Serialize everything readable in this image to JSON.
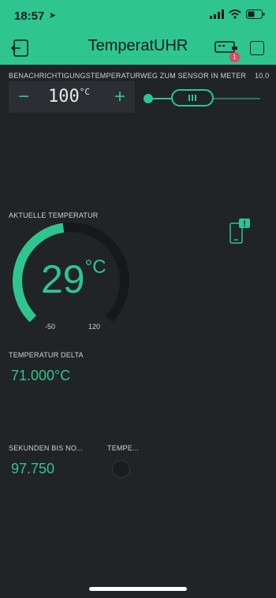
{
  "status": {
    "time": "18:57"
  },
  "header": {
    "title": "TemperatUHR",
    "notification_badge": "1"
  },
  "widgets": {
    "notify_temp": {
      "label": "BENACHRICHTIGUNGSTEMPERATUR",
      "minus": "−",
      "plus": "+",
      "value": "100",
      "unit": "°C"
    },
    "distance_slider": {
      "label": "WEG ZUM SENSOR IN METER",
      "value": "10.0",
      "level_fraction": 0.35
    },
    "current_temp": {
      "label": "AKTUELLE TEMPERATUR",
      "value": "29",
      "unit": "°C",
      "min": "-50",
      "max": "120",
      "level_fraction": 0.47
    },
    "temp_delta": {
      "label": "TEMPERATUR DELTA",
      "value": "71.000°C"
    },
    "seconds": {
      "label": "SEKUNDEN BIS NO...",
      "value": "97.750"
    },
    "temp_led": {
      "label": "TEMPE..."
    }
  },
  "colors": {
    "accent": "#2ec590",
    "background": "#212427",
    "badge": "#e0475a"
  }
}
